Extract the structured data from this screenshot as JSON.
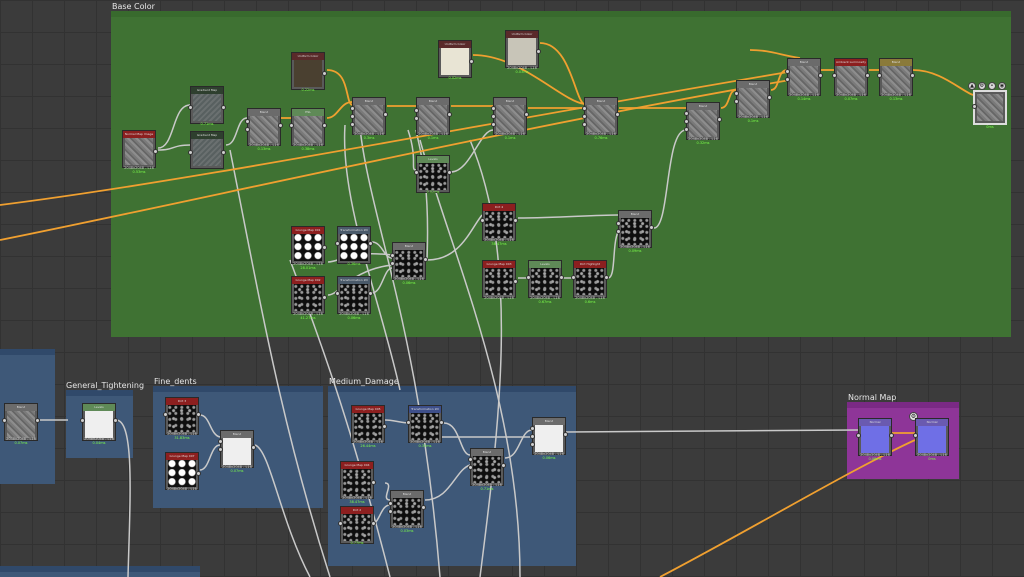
{
  "frames": {
    "base_color": "Base Color",
    "general_tightening": "General_Tightening",
    "fine_dents": "Fine_dents",
    "medium_damage": "Medium_Damage",
    "normal_map": "Normal Map"
  },
  "colors": {
    "base_frame": "#3f7233",
    "blue_frame": "#3e5878",
    "purple_frame": "#8e3598",
    "wire": "#c9c9c9",
    "wire_accent": "#f0a030",
    "time_ok": "#7cff4a",
    "time_slow": "#ff5a3a"
  },
  "icons": [
    "export-icon",
    "settings-icon",
    "pin-icon",
    "preview-icon"
  ],
  "nodes": [
    {
      "label": "Normal Map Image",
      "res": "2048x2048 - L16",
      "time": "0.53ms",
      "slow": false
    },
    {
      "label": "Gradient Map",
      "res": "",
      "time": "0.71ms",
      "slow": false
    },
    {
      "label": "Gradient Map",
      "res": "",
      "time": "",
      "slow": false
    },
    {
      "label": "Blend",
      "res": "2048x2048 - L16",
      "time": "0.13ms",
      "slow": false
    },
    {
      "label": "Uniform Color",
      "res": "",
      "time": "0.22ms",
      "slow": false
    },
    {
      "label": "HSL",
      "res": "2048x2048 - L16",
      "time": "0.38ms",
      "slow": false
    },
    {
      "label": "Blend",
      "res": "2048x2048 - L16",
      "time": "0.3ms",
      "slow": false
    },
    {
      "label": "Uniform Color",
      "res": "",
      "time": "0.02ms",
      "slow": false
    },
    {
      "label": "Blend",
      "res": "2048x2048 - L16",
      "time": "0.1ms",
      "slow": false
    },
    {
      "label": "Uniform Color",
      "res": "2048x2048 - L16",
      "time": "0.03ms",
      "slow": false
    },
    {
      "label": "Blend",
      "res": "2048x2048 - L16",
      "time": "0.1ms",
      "slow": false
    },
    {
      "label": "Blend",
      "res": "2048x2048 - L16",
      "time": "0.76ms",
      "slow": false
    },
    {
      "label": "Blend",
      "res": "2048x2048 - L16",
      "time": "0.32ms",
      "slow": false
    },
    {
      "label": "Blend",
      "res": "2048x2048 - L16",
      "time": "0.1ms",
      "slow": false
    },
    {
      "label": "Blend",
      "res": "2048x2048 - L16",
      "time": "0.14ms",
      "slow": false
    },
    {
      "label": "Ambient Luminosity",
      "res": "2048x2048 - L16",
      "time": "0.07ms",
      "slow": false
    },
    {
      "label": "Blend",
      "res": "2048x2048 - L16",
      "time": "0.13ms",
      "slow": false
    },
    {
      "label": "",
      "res": "",
      "time": "0ms",
      "slow": false
    },
    {
      "label": "Levels",
      "res": "",
      "time": "0.02ms",
      "slow": false
    },
    {
      "label": "Grunge Map 001",
      "res": "2048x2048 - L16",
      "time": "28.01ms",
      "slow": false
    },
    {
      "label": "Transformation 2D",
      "res": "",
      "time": "0.36ms",
      "slow": false
    },
    {
      "label": "Grunge Map 002",
      "res": "2048x2048 - L16",
      "time": "41.27ms",
      "slow": false
    },
    {
      "label": "Transformation 2D",
      "res": "2048x2048 - L16",
      "time": "0.06ms",
      "slow": false
    },
    {
      "label": "Blend",
      "res": "2048x2048 - L16",
      "time": "0.06ms",
      "slow": false
    },
    {
      "label": "Dirt 4",
      "res": "2048x2048 - L16",
      "time": "38.47ms",
      "slow": false
    },
    {
      "label": "Blend",
      "res": "2048x2048 - L16",
      "time": "0.09ms",
      "slow": false
    },
    {
      "label": "Grunge Map 003",
      "res": "2048x2048 - L16",
      "time": "",
      "slow": true
    },
    {
      "label": "Levels",
      "res": "2048x2048 - L16",
      "time": "0.67ms",
      "slow": false
    },
    {
      "label": "Dirt Highlight",
      "res": "2048x2048 - L16",
      "time": "0.6ms",
      "slow": false
    },
    {
      "label": "Blend",
      "res": "2048x2048 - L16",
      "time": "0.07ms",
      "slow": false
    },
    {
      "label": "Levels",
      "res": "2048x2048 - L16",
      "time": "0.04ms",
      "slow": false
    },
    {
      "label": "Dirt 3",
      "res": "2048x2048 - L16",
      "time": "31.83ms",
      "slow": false
    },
    {
      "label": "Grunge Map 007",
      "res": "2048x2048 - L16",
      "time": "",
      "slow": true
    },
    {
      "label": "Blend",
      "res": "2048x2048 - L16",
      "time": "0.07ms",
      "slow": false
    },
    {
      "label": "Grunge Map 005",
      "res": "2048x2048 - L16",
      "time": "26.44ms",
      "slow": false
    },
    {
      "label": "Transformation 2D",
      "res": "2048x2048 - L16",
      "time": "0.31ms",
      "slow": false
    },
    {
      "label": "Grunge Map 004",
      "res": "2048x2048 - L16",
      "time": "38.47ms",
      "slow": false
    },
    {
      "label": "Blend",
      "res": "2048x2048 - L16",
      "time": "0.71ms",
      "slow": false
    },
    {
      "label": "Blend",
      "res": "2048x2048 - L16",
      "time": "0.03ms",
      "slow": false
    },
    {
      "label": "Dirt 2",
      "res": "",
      "time": "0.77ms",
      "slow": false
    },
    {
      "label": "Blend",
      "res": "2048x2048 - L16",
      "time": "0.06ms",
      "slow": false
    },
    {
      "label": "Blend",
      "res": "2048x2048 - L16",
      "time": "0.07ms",
      "slow": false
    },
    {
      "label": "Normal",
      "res": "2048x2048 - L16",
      "time": "0.08ms",
      "slow": false
    },
    {
      "label": "Normal",
      "res": "2048x2048 - L16",
      "time": "0ms",
      "slow": false
    }
  ]
}
